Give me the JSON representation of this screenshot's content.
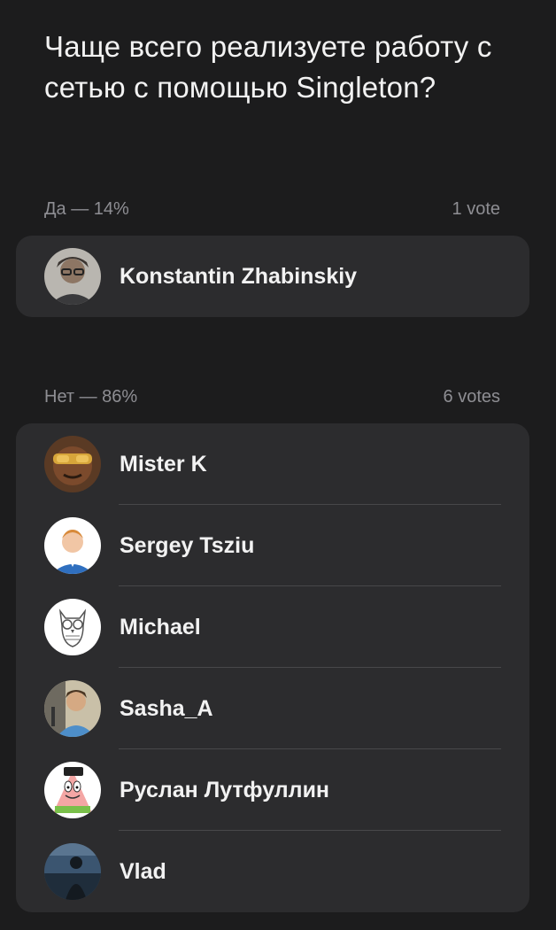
{
  "poll": {
    "question": "Чаще всего реализуете работу с сетью с помощью Singleton?",
    "options": [
      {
        "label": "Да — 14%",
        "votes": "1 vote",
        "percent": 14,
        "voters": [
          {
            "name": "Konstantin Zhabinskiy",
            "avatar": "avatar-photo-man-glasses"
          }
        ]
      },
      {
        "label": "Нет — 86%",
        "votes": "6 votes",
        "percent": 86,
        "voters": [
          {
            "name": "Mister K",
            "avatar": "avatar-photo-sunglasses"
          },
          {
            "name": "Sergey Tsziu",
            "avatar": "avatar-photo-man-blue-shirt"
          },
          {
            "name": "Michael",
            "avatar": "avatar-owl-drawing"
          },
          {
            "name": "Sasha_A",
            "avatar": "avatar-photo-singer"
          },
          {
            "name": "Руслан Лутфуллин",
            "avatar": "avatar-patrick-star"
          },
          {
            "name": "Vlad",
            "avatar": "avatar-photo-dark-silhouette"
          }
        ]
      }
    ]
  },
  "colors": {
    "background": "#1c1c1d",
    "card": "#2c2c2e",
    "secondary_text": "#8e8e93",
    "separator": "#48484a"
  }
}
